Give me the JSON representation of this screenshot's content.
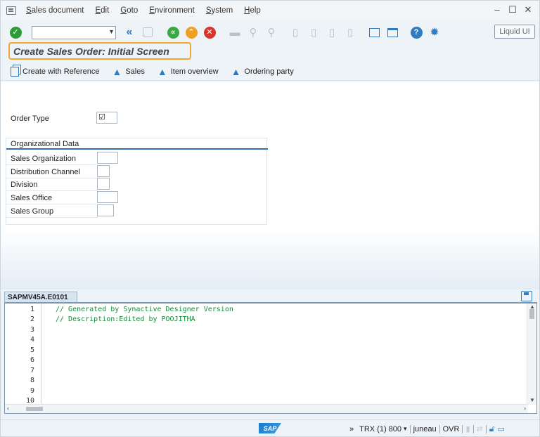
{
  "menu": {
    "items": [
      "Sales document",
      "Edit",
      "Goto",
      "Environment",
      "System",
      "Help"
    ]
  },
  "window": {
    "minimize": "–",
    "maximize": "☐",
    "close": "✕"
  },
  "toolbar": {
    "command_value": "",
    "liquid_ui_label": "Liquid UI"
  },
  "screen": {
    "title": "Create Sales Order: Initial Screen"
  },
  "app_toolbar": {
    "create_with_reference": "Create with Reference",
    "sales": "Sales",
    "item_overview": "Item overview",
    "ordering_party": "Ordering party"
  },
  "form": {
    "order_type_label": "Order Type",
    "order_type_value": "☑",
    "org_data_title": "Organizational Data",
    "sales_organization_label": "Sales Organization",
    "distribution_channel_label": "Distribution Channel",
    "division_label": "Division",
    "sales_office_label": "Sales Office",
    "sales_group_label": "Sales Group"
  },
  "editor": {
    "tab_label": "SAPMV45A.E0101",
    "line_numbers": [
      "1",
      "2",
      "3",
      "4",
      "5",
      "6",
      "7",
      "8",
      "9",
      "10"
    ],
    "lines": [
      "// Generated by Synactive Designer Version",
      "// Description:Edited by POOJITHA"
    ]
  },
  "status": {
    "expand": "»",
    "system": "TRX (1) 800",
    "user": "juneau",
    "mode": "OVR",
    "sap_logo": "SAP"
  },
  "colors": {
    "accent_blue": "#2f7cc0",
    "title_highlight": "#f0a830",
    "ok_green": "#2e9b3a",
    "nav_green": "#3aa845",
    "nav_orange": "#f0a020",
    "cancel_red": "#d9342b",
    "code_green": "#1a8a3a"
  }
}
